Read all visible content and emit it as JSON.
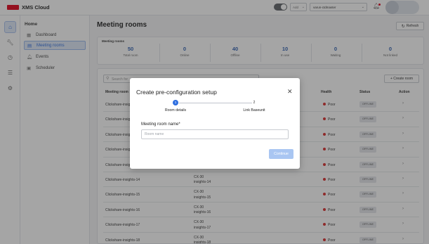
{
  "app": {
    "title": "XMS Cloud"
  },
  "topbar": {
    "add_label": "Add",
    "user_label": "varun-ctdmaster"
  },
  "nav": {
    "home_label": "Home",
    "items": [
      {
        "label": "Dashboard",
        "icon": "grid-icon"
      },
      {
        "label": "Meeting rooms",
        "icon": "room-icon",
        "active": true
      },
      {
        "label": "Events",
        "icon": "bell-icon"
      },
      {
        "label": "Scheduler",
        "icon": "calendar-icon"
      }
    ]
  },
  "page": {
    "title": "Meeting rooms",
    "refresh_label": "Refresh"
  },
  "stats": {
    "title": "Meeting rooms",
    "items": [
      {
        "value": "50",
        "label": "Total room"
      },
      {
        "value": "0",
        "label": "Online"
      },
      {
        "value": "40",
        "label": "Offline"
      },
      {
        "value": "10",
        "label": "In use"
      },
      {
        "value": "0",
        "label": "Waiting"
      },
      {
        "value": "0",
        "label": "Not linked"
      }
    ]
  },
  "table": {
    "search_placeholder": "Search for",
    "create_label": "+ Create room",
    "columns": {
      "name": "Meeting room",
      "health": "Health",
      "status": "Status",
      "action": "Action"
    },
    "rows": [
      {
        "name": "Clickshare-insights-",
        "model": "",
        "unit": "",
        "health": "Poor",
        "status": "OFFLINE"
      },
      {
        "name": "Clickshare-insights-",
        "model": "",
        "unit": "",
        "health": "Poor",
        "status": "OFFLINE"
      },
      {
        "name": "Clickshare-insights-",
        "model": "",
        "unit": "",
        "health": "Poor",
        "status": "OFFLINE"
      },
      {
        "name": "Clickshare-insights-",
        "model": "",
        "unit": "",
        "health": "Poor",
        "status": "OFFLINE"
      },
      {
        "name": "Clickshare-insights-",
        "model": "",
        "unit": "",
        "health": "Poor",
        "status": "OFFLINE"
      },
      {
        "name": "Clickshare-insights-14",
        "model": "CX-30",
        "unit": "insights-14",
        "health": "Poor",
        "status": "OFFLINE"
      },
      {
        "name": "Clickshare-insights-15",
        "model": "CX-30",
        "unit": "insights-15",
        "health": "Poor",
        "status": "OFFLINE"
      },
      {
        "name": "Clickshare-insights-16",
        "model": "CX-30",
        "unit": "insights-16",
        "health": "Poor",
        "status": "OFFLINE"
      },
      {
        "name": "Clickshare-insights-17",
        "model": "CX-30",
        "unit": "insights-17",
        "health": "Poor",
        "status": "OFFLINE"
      },
      {
        "name": "Clickshare-insights-18",
        "model": "CX-30",
        "unit": "insights-18",
        "health": "Poor",
        "status": "OFFLINE"
      }
    ]
  },
  "modal": {
    "title": "Create pre-configuration setup",
    "steps": [
      {
        "number": "1",
        "label": "Room details"
      },
      {
        "number": "2",
        "label": "Link Baseunit"
      }
    ],
    "field_label": "Meeting room name*",
    "field_placeholder": "Room name",
    "field_value": "",
    "continue_label": "Continue"
  },
  "colors": {
    "accent": "#2f6fe0",
    "brand": "#e2001a",
    "poor": "#d92b2b"
  }
}
